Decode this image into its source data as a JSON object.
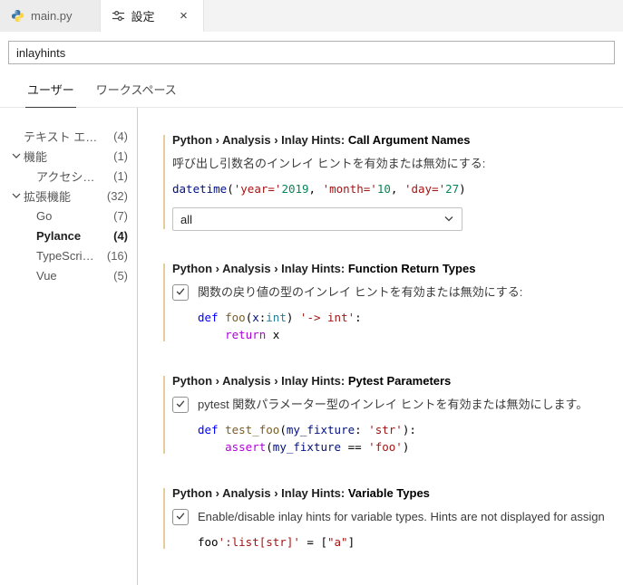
{
  "editor_tabs": [
    {
      "label": "main.py",
      "icon": "python-icon"
    },
    {
      "label": "設定",
      "icon": "settings-icon",
      "close": "×"
    }
  ],
  "search": {
    "value": "inlayhints"
  },
  "scope_tabs": [
    {
      "label": "ユーザー",
      "active": true
    },
    {
      "label": "ワークスペース",
      "active": false
    }
  ],
  "toc": [
    {
      "label": "テキスト エ…",
      "count": "(4)"
    },
    {
      "label": "機能",
      "count": "(1)",
      "expanded": true
    },
    {
      "label": "アクセシ…",
      "count": "(1)"
    },
    {
      "label": "拡張機能",
      "count": "(32)",
      "expanded": true
    },
    {
      "label": "Go",
      "count": "(7)"
    },
    {
      "label": "Pylance",
      "count": "(4)",
      "selected": true
    },
    {
      "label": "TypeScri…",
      "count": "(16)"
    },
    {
      "label": "Vue",
      "count": "(5)"
    }
  ],
  "settings": [
    {
      "category": "Python › Analysis › Inlay Hints: ",
      "label": "Call Argument Names",
      "description": "呼び出し引数名のインレイ ヒントを有効または無効にする:",
      "value": "all",
      "code": [
        [
          {
            "t": "datetime",
            "c": "var"
          },
          {
            "t": "(",
            "c": "plain"
          },
          {
            "t": "'year='",
            "c": "str"
          },
          {
            "t": "2019",
            "c": "num"
          },
          {
            "t": ", ",
            "c": "plain"
          },
          {
            "t": "'month='",
            "c": "str"
          },
          {
            "t": "10",
            "c": "num"
          },
          {
            "t": ", ",
            "c": "plain"
          },
          {
            "t": "'day='",
            "c": "str"
          },
          {
            "t": "27",
            "c": "num"
          },
          {
            "t": ")",
            "c": "plain"
          }
        ]
      ]
    },
    {
      "category": "Python › Analysis › Inlay Hints: ",
      "label": "Function Return Types",
      "description": "関数の戻り値の型のインレイ ヒントを有効または無効にする:",
      "checked": true,
      "code": [
        [
          {
            "t": "def",
            "c": "kw"
          },
          {
            "t": " ",
            "c": "plain"
          },
          {
            "t": "foo",
            "c": "fn"
          },
          {
            "t": "(",
            "c": "plain"
          },
          {
            "t": "x",
            "c": "var"
          },
          {
            "t": ":",
            "c": "plain"
          },
          {
            "t": "int",
            "c": "type"
          },
          {
            "t": ") ",
            "c": "plain"
          },
          {
            "t": "'-> int'",
            "c": "str"
          },
          {
            "t": ":",
            "c": "plain"
          }
        ],
        [
          {
            "t": "    ",
            "c": "plain"
          },
          {
            "t": "return",
            "c": "ctrl"
          },
          {
            "t": " x",
            "c": "plain"
          }
        ]
      ]
    },
    {
      "category": "Python › Analysis › Inlay Hints: ",
      "label": "Pytest Parameters",
      "description": "pytest 関数パラメーター型のインレイ ヒントを有効または無効にします。",
      "checked": true,
      "code": [
        [
          {
            "t": "def",
            "c": "kw"
          },
          {
            "t": " ",
            "c": "plain"
          },
          {
            "t": "test_foo",
            "c": "fn"
          },
          {
            "t": "(",
            "c": "plain"
          },
          {
            "t": "my_fixture",
            "c": "var"
          },
          {
            "t": ": ",
            "c": "plain"
          },
          {
            "t": "'str'",
            "c": "str"
          },
          {
            "t": "):",
            "c": "plain"
          }
        ],
        [
          {
            "t": "    ",
            "c": "plain"
          },
          {
            "t": "assert",
            "c": "ctrl"
          },
          {
            "t": "(",
            "c": "plain"
          },
          {
            "t": "my_fixture",
            "c": "var"
          },
          {
            "t": " == ",
            "c": "plain"
          },
          {
            "t": "'foo'",
            "c": "str"
          },
          {
            "t": ")",
            "c": "plain"
          }
        ]
      ]
    },
    {
      "category": "Python › Analysis › Inlay Hints: ",
      "label": "Variable Types",
      "description": "Enable/disable inlay hints for variable types. Hints are not displayed for assign",
      "checked": true,
      "code": [
        [
          {
            "t": "foo",
            "c": "plain"
          },
          {
            "t": "':list[str]'",
            "c": "str"
          },
          {
            "t": " = [",
            "c": "plain"
          },
          {
            "t": "\"a\"",
            "c": "str"
          },
          {
            "t": "]",
            "c": "plain"
          }
        ]
      ]
    }
  ],
  "syntax_colors": {
    "kw": "#0000ff",
    "fn": "#795e26",
    "var": "#001080",
    "type": "#267f99",
    "str": "#a31515",
    "num": "#098658",
    "ctrl": "#af00db",
    "plain": "#000000"
  },
  "colors": {
    "modified_indicator": "#bb800966",
    "tab_bar_background": "#f3f3f3",
    "active_tab_background": "#ffffff"
  }
}
